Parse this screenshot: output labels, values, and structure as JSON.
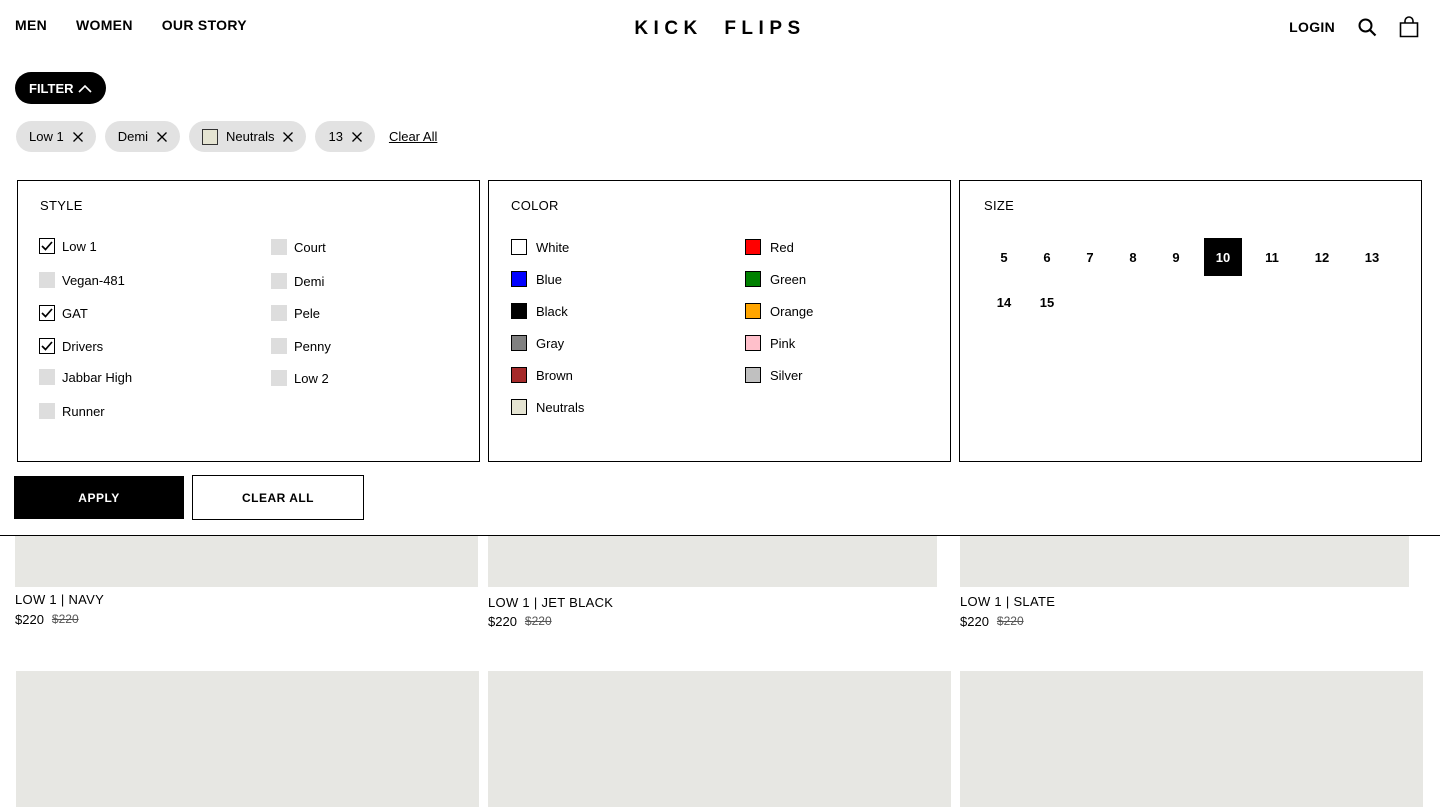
{
  "header": {
    "nav": [
      "MEN",
      "WOMEN",
      "OUR STORY"
    ],
    "logo": "KICK  FLIPS",
    "login": "LOGIN"
  },
  "filter_toggle": "FILTER",
  "active_filters": {
    "chips": [
      "Low 1",
      "Demi",
      "Neutrals",
      "13"
    ],
    "chip_swatch_color": "#e5e4d2",
    "clear_all": "Clear All"
  },
  "style": {
    "title": "STYLE",
    "options": [
      {
        "label": "Low 1",
        "checked": true
      },
      {
        "label": "Vegan-481",
        "checked": false
      },
      {
        "label": "GAT",
        "checked": true
      },
      {
        "label": "Drivers",
        "checked": true
      },
      {
        "label": "Jabbar High",
        "checked": false
      },
      {
        "label": "Runner",
        "checked": false
      },
      {
        "label": "Court",
        "checked": false
      },
      {
        "label": "Demi",
        "checked": false
      },
      {
        "label": "Pele",
        "checked": false
      },
      {
        "label": "Penny",
        "checked": false
      },
      {
        "label": "Low 2",
        "checked": false
      }
    ]
  },
  "color": {
    "title": "COLOR",
    "options": [
      {
        "label": "White",
        "hex": "#ffffff"
      },
      {
        "label": "Blue",
        "hex": "#0000ff"
      },
      {
        "label": "Black",
        "hex": "#000000"
      },
      {
        "label": "Gray",
        "hex": "#808080"
      },
      {
        "label": "Brown",
        "hex": "#a52a2a"
      },
      {
        "label": "Neutrals",
        "hex": "#e5e4d2"
      },
      {
        "label": "Red",
        "hex": "#ff0000"
      },
      {
        "label": "Green",
        "hex": "#008000"
      },
      {
        "label": "Orange",
        "hex": "#ffa500"
      },
      {
        "label": "Pink",
        "hex": "#ffc0cb"
      },
      {
        "label": "Silver",
        "hex": "#c0c0c0"
      }
    ]
  },
  "size": {
    "title": "SIZE",
    "options": [
      "5",
      "6",
      "7",
      "8",
      "9",
      "10",
      "11",
      "12",
      "13",
      "14",
      "15"
    ],
    "selected": "10"
  },
  "buttons": {
    "apply": "APPLY",
    "clear_all": "CLEAR ALL"
  },
  "products": [
    {
      "name": "LOW 1 | NAVY",
      "price": "$220",
      "compare_price": "$220"
    },
    {
      "name": "LOW 1 | JET BLACK",
      "price": "$220",
      "compare_price": "$220"
    },
    {
      "name": "LOW 1 | SLATE",
      "price": "$220",
      "compare_price": "$220"
    }
  ],
  "colors": {
    "image_placeholder": "#e7e7e3",
    "chip_bg": "#e2e2e2",
    "checkbox_off": "#dddddd"
  }
}
